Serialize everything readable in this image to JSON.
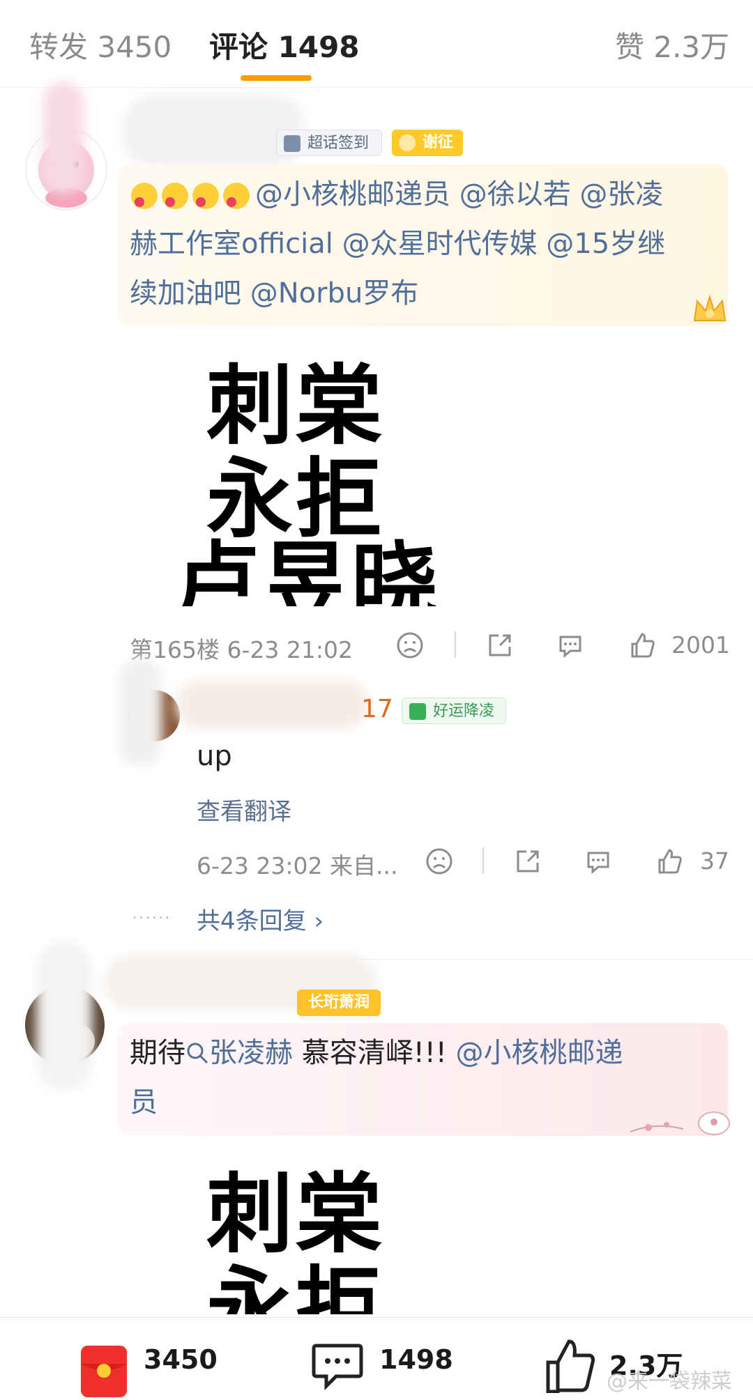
{
  "tabs": {
    "repost": "转发 3450",
    "comments": "评论 1498",
    "likes": "赞 2.3万"
  },
  "comment1": {
    "badge_checkin": "超话签到",
    "badge_level": "谢征",
    "text_line1": "@小核桃邮递员 @徐以若 @张凌",
    "text_line2": "赫工作室official @众星时代传媒 @15岁继",
    "text_line3": "续加油吧 @Norbu罗布",
    "image_lines": [
      "刺棠",
      "永拒",
      "卢昱晓"
    ],
    "floor_time": "第165楼 6-23 21:02",
    "likes": "2001"
  },
  "reply1": {
    "name_suffix": "17",
    "badge": "好运降凌",
    "text": "up",
    "translate": "查看翻译",
    "time_source": "6-23 23:02 来自...",
    "likes": "37",
    "dots": "······",
    "more": "共4条回复 ›"
  },
  "comment2": {
    "badge": "长珩萧润",
    "text_prefix": "期待",
    "search_term": "张凌赫",
    "text_mid": " 慕容清峄!!! ",
    "mention": "@小核桃邮递",
    "text_line2": "员",
    "image_lines": [
      "刺棠",
      "永拒"
    ]
  },
  "bottom": {
    "reposts": "3450",
    "comments": "1498",
    "likes": "2.3万"
  },
  "watermark": "@来一袋辣菜"
}
